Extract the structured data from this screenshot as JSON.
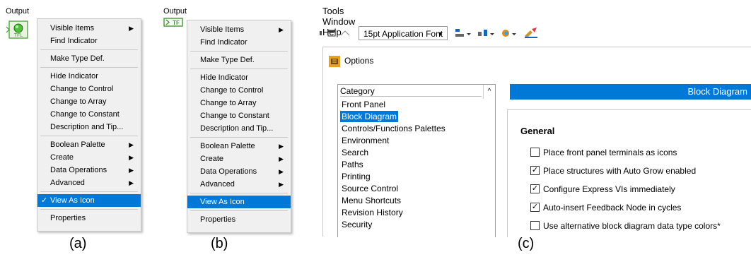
{
  "panel_a": {
    "output_label": "Output",
    "menu": [
      {
        "label": "Visible Items",
        "submenu": true
      },
      {
        "label": "Find Indicator"
      },
      {
        "sep": true
      },
      {
        "label": "Make Type Def."
      },
      {
        "sep": true
      },
      {
        "label": "Hide Indicator"
      },
      {
        "label": "Change to Control"
      },
      {
        "label": "Change to Array"
      },
      {
        "label": "Change to Constant"
      },
      {
        "label": "Description and Tip..."
      },
      {
        "sep": true
      },
      {
        "label": "Boolean Palette",
        "submenu": true
      },
      {
        "label": "Create",
        "submenu": true
      },
      {
        "label": "Data Operations",
        "submenu": true
      },
      {
        "label": "Advanced",
        "submenu": true
      },
      {
        "sep": true
      },
      {
        "label": "View As Icon",
        "checked": true,
        "selected": true
      },
      {
        "sep": true
      },
      {
        "label": "Properties"
      }
    ],
    "caption": "(a)",
    "terminal_text": "TFL"
  },
  "panel_b": {
    "output_label": "Output",
    "menu": [
      {
        "label": "Visible Items",
        "submenu": true
      },
      {
        "label": "Find Indicator"
      },
      {
        "sep": true
      },
      {
        "label": "Make Type Def."
      },
      {
        "sep": true
      },
      {
        "label": "Hide Indicator"
      },
      {
        "label": "Change to Control"
      },
      {
        "label": "Change to Array"
      },
      {
        "label": "Change to Constant"
      },
      {
        "label": "Description and Tip..."
      },
      {
        "sep": true
      },
      {
        "label": "Boolean Palette",
        "submenu": true
      },
      {
        "label": "Create",
        "submenu": true
      },
      {
        "label": "Data Operations",
        "submenu": true
      },
      {
        "label": "Advanced",
        "submenu": true
      },
      {
        "sep": true
      },
      {
        "label": "View As Icon",
        "checked": false,
        "selected": true
      },
      {
        "sep": true
      },
      {
        "label": "Properties"
      }
    ],
    "caption": "(b)",
    "terminal_text": "TF"
  },
  "panel_c": {
    "menubar": [
      "Tools",
      "Window",
      "Help"
    ],
    "toolbar": {
      "font_selector": "15pt Application Font"
    },
    "dialog_title": "Options",
    "category_header": "Category",
    "categories": [
      {
        "label": "Front Panel"
      },
      {
        "label": "Block Diagram",
        "selected": true
      },
      {
        "label": "Controls/Functions Palettes"
      },
      {
        "label": "Environment"
      },
      {
        "label": "Search"
      },
      {
        "label": "Paths"
      },
      {
        "label": "Printing"
      },
      {
        "label": "Source Control"
      },
      {
        "label": "Menu Shortcuts"
      },
      {
        "label": "Revision History"
      },
      {
        "label": "Security"
      }
    ],
    "section_header": "Block Diagram",
    "group_label": "General",
    "options": [
      {
        "label": "Place front panel terminals as icons",
        "checked": false
      },
      {
        "label": "Place structures with Auto Grow enabled",
        "checked": true
      },
      {
        "label": "Configure Express VIs immediately",
        "checked": true
      },
      {
        "label": "Auto-insert Feedback Node in cycles",
        "checked": true
      },
      {
        "label": "Use alternative block diagram data type colors*",
        "checked": false
      }
    ],
    "caption": "(c)"
  },
  "colors": {
    "selection": "#0078d7",
    "terminal_green": "#3a9a2a"
  }
}
